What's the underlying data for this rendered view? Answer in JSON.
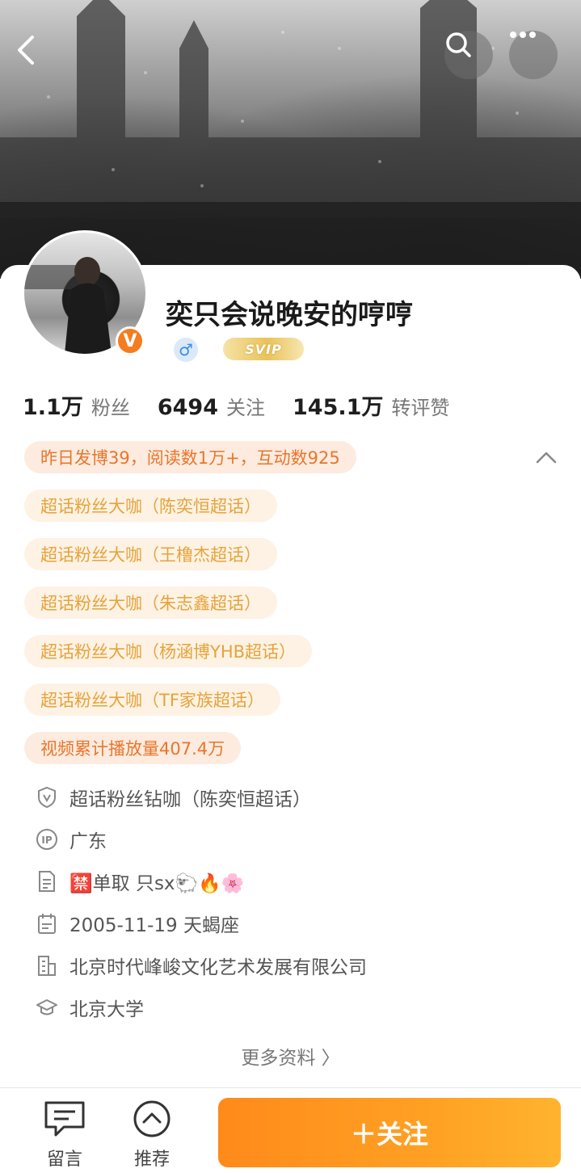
{
  "profile": {
    "username": "奕只会说晚安的哼哼",
    "gender_symbol": "♂",
    "svip_label": "SVIP",
    "verified_badge": "V"
  },
  "stats": [
    {
      "value": "1.1万",
      "label": "粉丝"
    },
    {
      "value": "6494",
      "label": "关注"
    },
    {
      "value": "145.1万",
      "label": "转评赞"
    }
  ],
  "highlight": "昨日发博39，阅读数1万+，互动数925",
  "badges": [
    "超话粉丝大咖（陈奕恒超话）",
    "超话粉丝大咖（王橹杰超话）",
    "超话粉丝大咖（朱志鑫超话）",
    "超话粉丝大咖（杨涵博YHB超话）",
    "超话粉丝大咖（TF家族超话）"
  ],
  "video_play": "视频累计播放量407.4万",
  "info": {
    "super_fan": "超话粉丝钻咖（陈奕恒超话）",
    "ip_location": "广东",
    "bio": "🈲单取 只sx🐑🔥🌸",
    "birthday": "2005-11-19 天蝎座",
    "company": "北京时代峰峻文化艺术发展有限公司",
    "school": "北京大学"
  },
  "more_info": "更多资料 〉",
  "bottom_bar": {
    "message_label": "留言",
    "recommend_label": "推荐",
    "follow_label": "＋关注"
  },
  "colors": {
    "accent_orange": "#ff8a1a",
    "badge_gold": "#e6a33a",
    "pill_bg": "#fdf2e4",
    "gender_blue": "#3a8ee6"
  }
}
